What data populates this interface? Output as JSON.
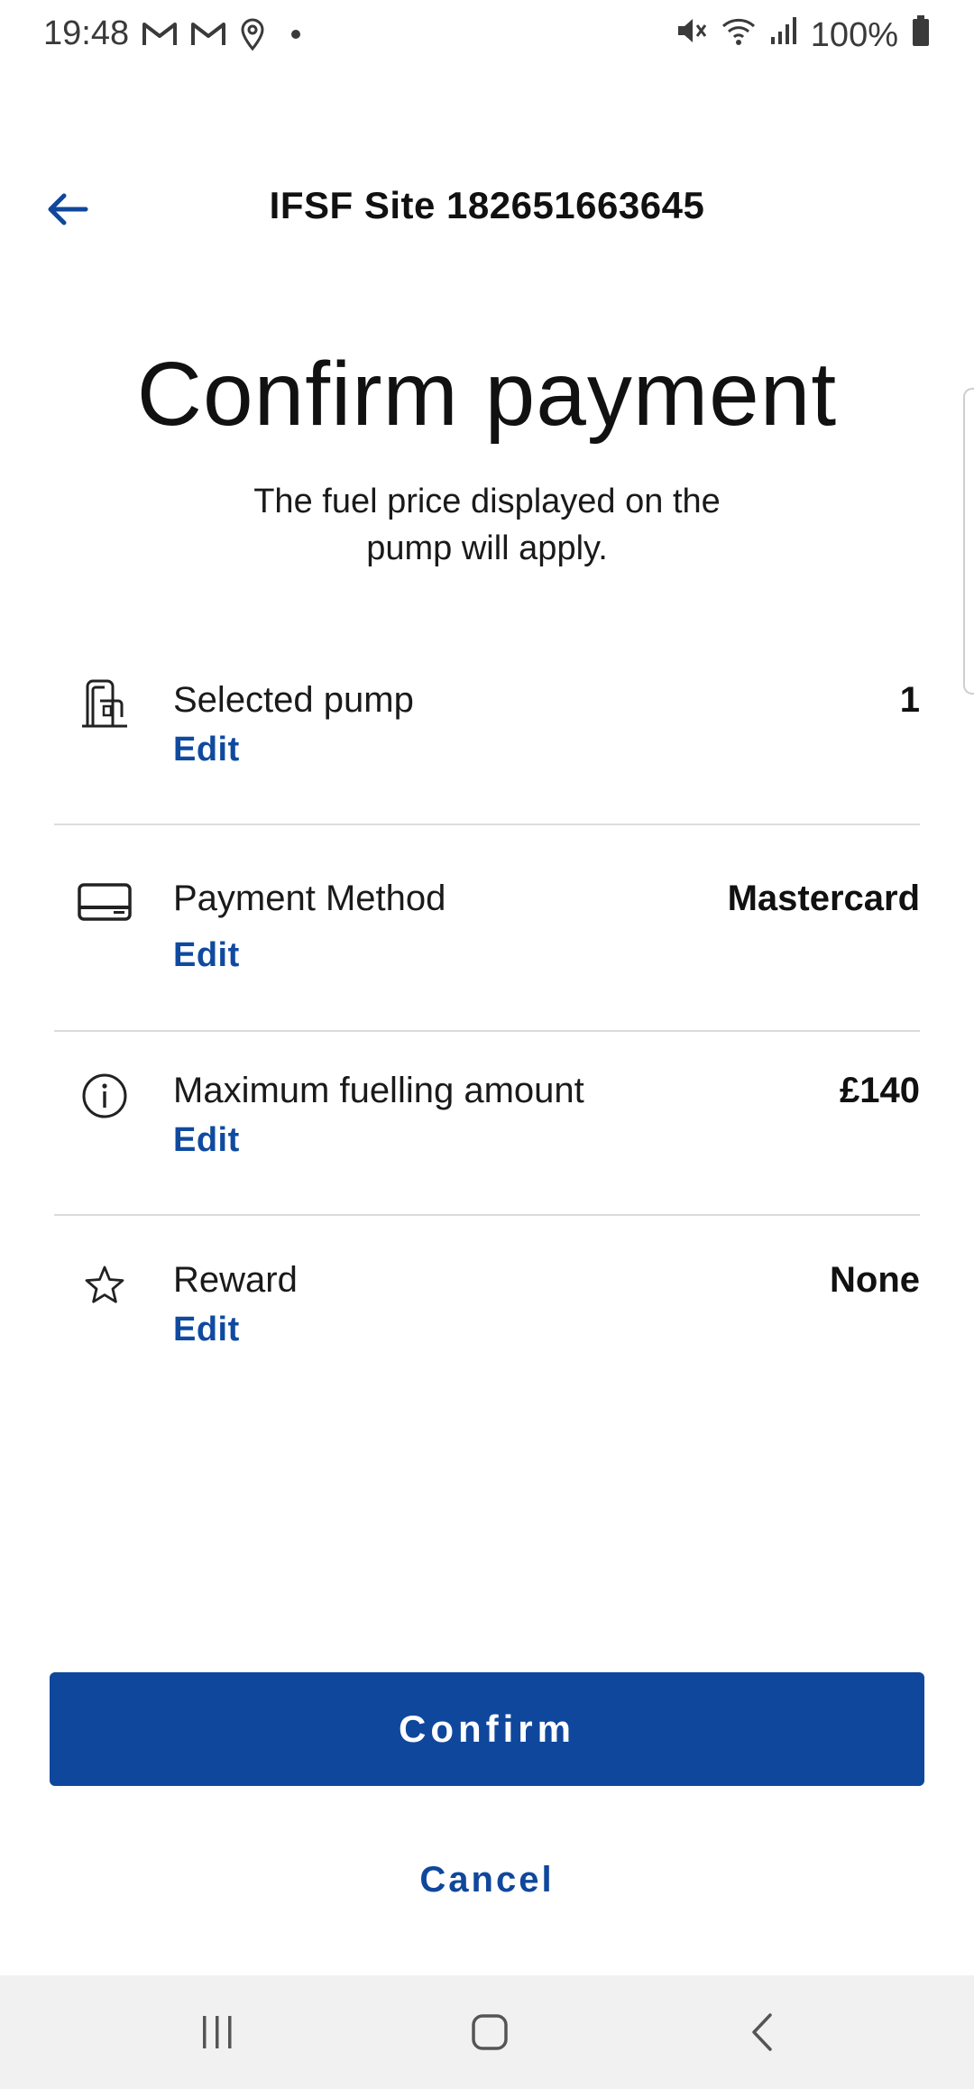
{
  "status_bar": {
    "time": "19:48",
    "battery": "100%",
    "left_icons": [
      "gmail-icon",
      "gmail-icon",
      "location-icon"
    ],
    "right_icons": [
      "mute-icon",
      "wifi-icon",
      "signal-icon",
      "battery-icon"
    ]
  },
  "header": {
    "title": "IFSF Site 182651663645",
    "back_icon": "arrow-left-icon"
  },
  "main": {
    "title": "Confirm payment",
    "subtitle": "The fuel price displayed on the pump will apply."
  },
  "details": [
    {
      "icon": "fuel-pump-icon",
      "label": "Selected pump",
      "value": "1",
      "edit_label": "Edit"
    },
    {
      "icon": "credit-card-icon",
      "label": "Payment Method",
      "value": "Mastercard",
      "edit_label": "Edit"
    },
    {
      "icon": "info-icon",
      "label": "Maximum fuelling amount",
      "value": "£140",
      "edit_label": "Edit"
    },
    {
      "icon": "star-icon",
      "label": "Reward",
      "value": "None",
      "edit_label": "Edit"
    }
  ],
  "actions": {
    "confirm_label": "Confirm",
    "cancel_label": "Cancel"
  },
  "colors": {
    "accent": "#0f479c",
    "link": "#0f4aa0",
    "divider": "#dcdcdc",
    "nav_bar": "#f1f1f1"
  },
  "nav_bar": {
    "buttons": [
      "recent-apps-icon",
      "home-icon",
      "back-icon"
    ]
  }
}
